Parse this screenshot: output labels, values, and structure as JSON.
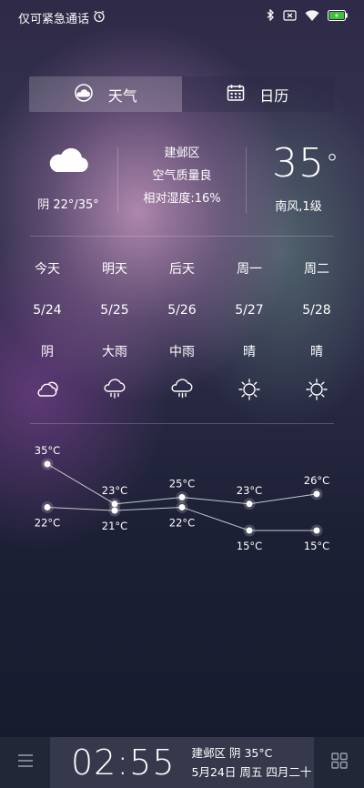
{
  "status_bar": {
    "carrier_text": "仅可紧急通话",
    "icons": [
      "alarm-icon",
      "bluetooth-icon",
      "sim-icon",
      "wifi-icon",
      "battery-icon"
    ],
    "battery_color": "#3fc23a"
  },
  "tabs": [
    {
      "label": "天气",
      "icon": "weather-icon",
      "active": true
    },
    {
      "label": "日历",
      "icon": "calendar-icon",
      "active": false
    }
  ],
  "current": {
    "condition_icon": "cloud-icon",
    "temp_range": "阴 22°/35°",
    "location": "建邺区",
    "air_quality": "空气质量良",
    "humidity": "相对湿度:16%",
    "temperature": "35",
    "degree": "°",
    "wind": "南风,1级"
  },
  "forecast": [
    {
      "day": "今天",
      "date": "5/24",
      "condition": "阴",
      "icon": "cloudy-icon",
      "high": "35°C",
      "low": "22°C"
    },
    {
      "day": "明天",
      "date": "5/25",
      "condition": "大雨",
      "icon": "heavy-rain-icon",
      "high": "23°C",
      "low": "21°C"
    },
    {
      "day": "后天",
      "date": "5/26",
      "condition": "中雨",
      "icon": "moderate-rain-icon",
      "high": "25°C",
      "low": "22°C"
    },
    {
      "day": "周一",
      "date": "5/27",
      "condition": "晴",
      "icon": "sunny-icon",
      "high": "23°C",
      "low": "15°C"
    },
    {
      "day": "周二",
      "date": "5/28",
      "condition": "晴",
      "icon": "sunny-icon",
      "high": "26°C",
      "low": "15°C"
    }
  ],
  "chart_data": {
    "type": "line",
    "categories": [
      "今天",
      "明天",
      "后天",
      "周一",
      "周二"
    ],
    "series": [
      {
        "values": [
          35,
          23,
          25,
          23,
          26
        ]
      },
      {
        "values": [
          22,
          21,
          22,
          15,
          15
        ]
      }
    ],
    "unit": "°C"
  },
  "bottom_bar": {
    "time": "02:55",
    "location_weather": "建邺区 阴 35°C",
    "date_line": "5月24日 周五 四月二十",
    "menu_icon": "menu-icon",
    "apps_icon": "app-grid-icon"
  }
}
